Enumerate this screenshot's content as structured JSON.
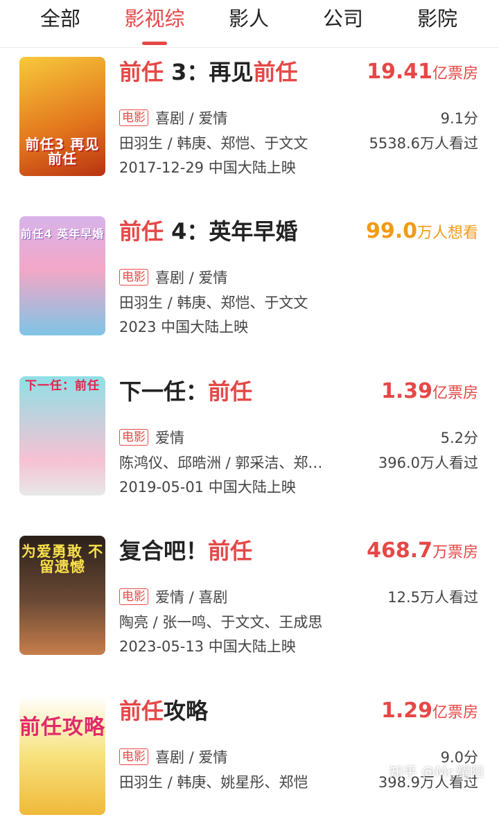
{
  "tabs": [
    {
      "label": "全部"
    },
    {
      "label": "影视综"
    },
    {
      "label": "影人"
    },
    {
      "label": "公司"
    },
    {
      "label": "影院"
    }
  ],
  "active_tab_index": 1,
  "movies": [
    {
      "title_parts": [
        "前任",
        " 3：再见",
        "前任"
      ],
      "metric_value": "19.41",
      "metric_unit": "亿票房",
      "metric_color": "#e54847",
      "badge": "电影",
      "genres": "喜剧 / 爱情",
      "rating": "9.1分",
      "cast": "田羽生 / 韩庚、郑恺、于文文",
      "views": "5538.6万人看过",
      "release": "2017-12-29 中国大陆上映",
      "poster_text": "前任3 再见前任",
      "poster_bg": "#f4b11e"
    },
    {
      "title_parts": [
        "前任",
        " 4：英年早婚",
        ""
      ],
      "metric_value": "99.0",
      "metric_unit": "万人想看",
      "metric_color": "#f29a15",
      "badge": "电影",
      "genres": "喜剧 / 爱情",
      "rating": "",
      "cast": "田羽生 / 韩庚、郑恺、于文文",
      "views": "",
      "release": "2023 中国大陆上映",
      "poster_text": "前任4 英年早婚",
      "poster_bg": "#c9a7df"
    },
    {
      "title_parts": [
        "",
        "下一任：",
        "前任"
      ],
      "metric_value": "1.39",
      "metric_unit": "亿票房",
      "metric_color": "#e54847",
      "badge": "电影",
      "genres": "爱情",
      "rating": "5.2分",
      "cast": "陈鸿仪、邱晧洲 / 郭采洁、郑…",
      "views": "396.0万人看过",
      "release": "2019-05-01 中国大陆上映",
      "poster_text": "下一任：前任",
      "poster_bg": "#7fd0d8"
    },
    {
      "title_parts": [
        "",
        "复合吧！",
        "前任"
      ],
      "metric_value": "468.7",
      "metric_unit": "万票房",
      "metric_color": "#e54847",
      "badge": "电影",
      "genres": "爱情 / 喜剧",
      "rating": "12.5万人看过",
      "cast": "陶亮 / 张一鸣、于文文、王成思",
      "views": "",
      "release": "2023-05-13 中国大陆上映",
      "poster_text": "为爱勇敢 不留遗憾",
      "poster_bg": "#3b2a22"
    },
    {
      "title_parts": [
        "前任",
        "攻略",
        ""
      ],
      "metric_value": "1.29",
      "metric_unit": "亿票房",
      "metric_color": "#e54847",
      "badge": "电影",
      "genres": "喜剧 / 爱情",
      "rating": "9.0分",
      "cast": "田羽生 / 韩庚、姚星彤、郑恺",
      "views": "398.9万人看过",
      "release": "",
      "poster_text": "前任攻略",
      "poster_bg": "#f2d46a"
    }
  ],
  "watermark": "知乎 @Mr.耀阳"
}
